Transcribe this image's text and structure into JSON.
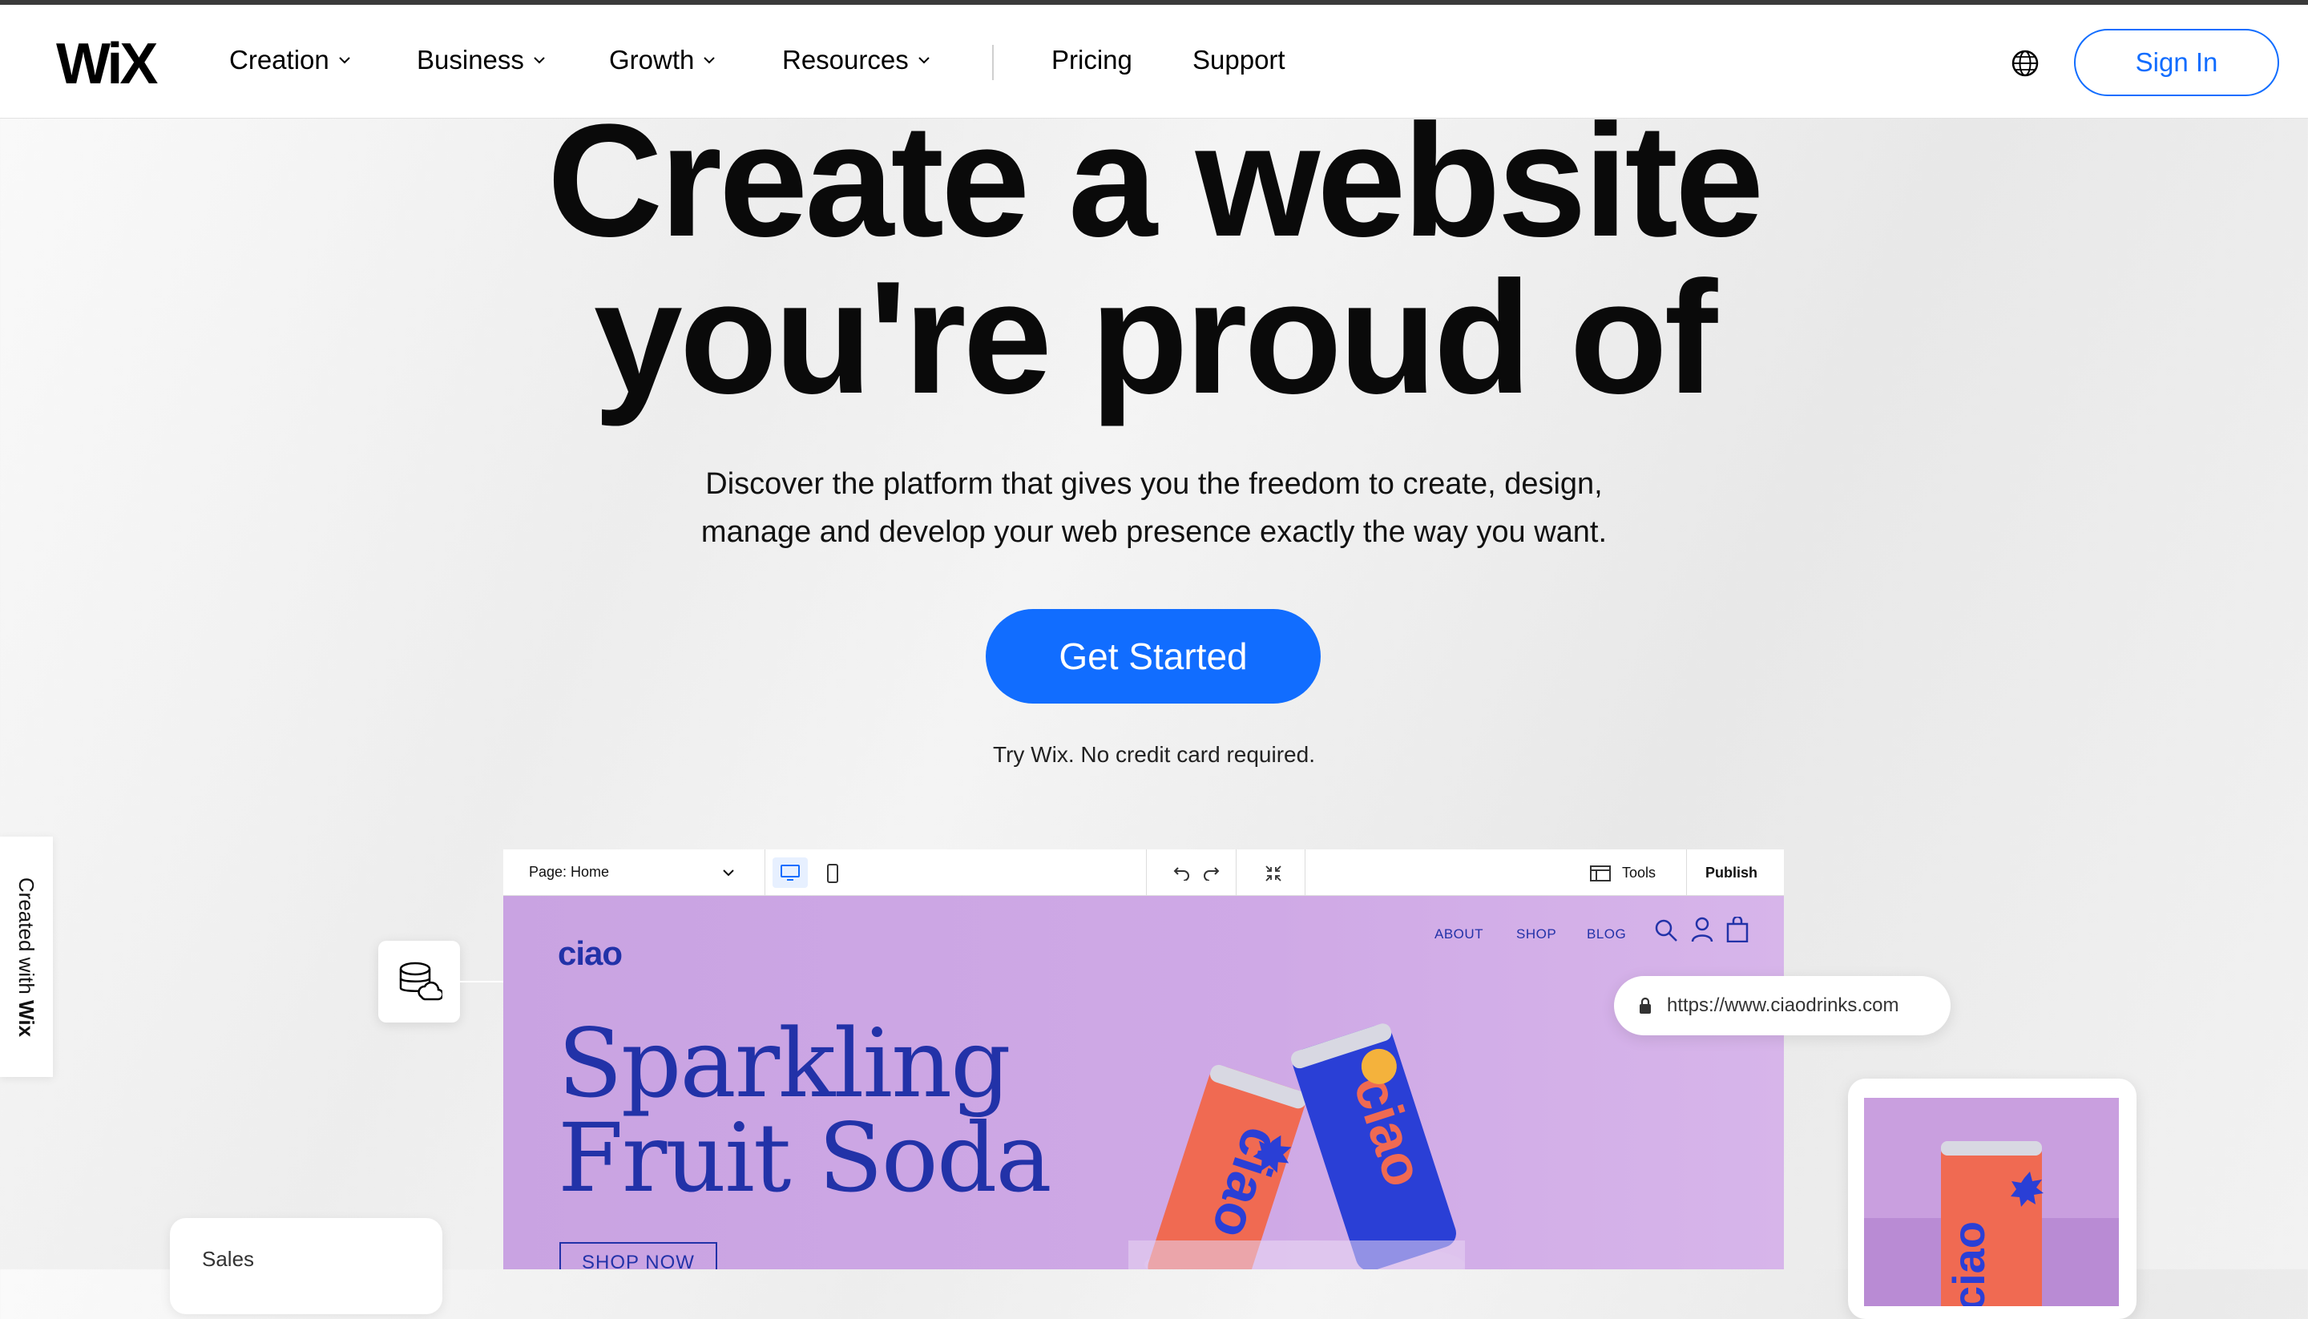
{
  "nav": {
    "logo": "WiX",
    "items": [
      "Creation",
      "Business",
      "Growth",
      "Resources"
    ],
    "links": [
      "Pricing",
      "Support"
    ],
    "sign_in": "Sign In"
  },
  "hero": {
    "title_line1": "Create a website",
    "title_line2": "you're proud of",
    "subtitle_line1": "Discover the platform that gives you the freedom to create, design,",
    "subtitle_line2": "manage and develop your web presence exactly the way you want.",
    "cta": "Get Started",
    "cta_note": "Try Wix. No credit card required."
  },
  "side_tab": {
    "prefix": "Created with ",
    "brand": "Wix"
  },
  "editor": {
    "page_selector": "Page: Home",
    "tools": "Tools",
    "publish": "Publish"
  },
  "site_preview": {
    "brand": "ciao",
    "nav": [
      "ABOUT",
      "SHOP",
      "BLOG"
    ],
    "headline_line1": "Sparkling",
    "headline_line2": "Fruit Soda",
    "button": "SHOP NOW",
    "can_label": "ciao"
  },
  "url_bar": {
    "url": "https://www.ciaodrinks.com"
  },
  "sales_card": {
    "label": "Sales"
  },
  "colors": {
    "accent": "#116dff",
    "site_bg": "#c9a3e2",
    "site_ink": "#2232a8",
    "can_orange": "#f06a52",
    "can_blue": "#2a3fd6"
  }
}
